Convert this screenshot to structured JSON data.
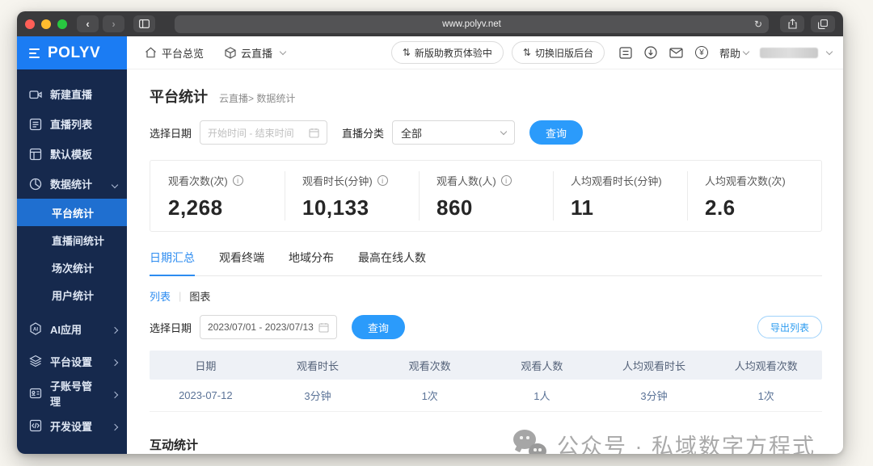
{
  "browser": {
    "url": "www.polyv.net"
  },
  "logo": {
    "text": "POLYV"
  },
  "header": {
    "nav_overview": "平台总览",
    "nav_product": "云直播",
    "pill_new_assistant": "新版助教页体验中",
    "pill_switch_old": "切换旧版后台",
    "help_label": "帮助"
  },
  "sidebar": {
    "items": [
      {
        "label": "新建直播"
      },
      {
        "label": "直播列表"
      },
      {
        "label": "默认模板"
      },
      {
        "label": "数据统计"
      }
    ],
    "sub_items": [
      {
        "label": "平台统计",
        "active": true
      },
      {
        "label": "直播间统计"
      },
      {
        "label": "场次统计"
      },
      {
        "label": "用户统计"
      }
    ],
    "group_items": [
      {
        "label": "AI应用"
      },
      {
        "label": "平台设置"
      },
      {
        "label": "子账号管理"
      },
      {
        "label": "开发设置"
      }
    ]
  },
  "main": {
    "title": "平台统计",
    "breadcrumb": "云直播> 数据统计",
    "filter1": {
      "date_label": "选择日期",
      "date_placeholder": "开始时间 - 结束时间",
      "category_label": "直播分类",
      "category_value": "全部",
      "search_label": "查询"
    },
    "stats": [
      {
        "label": "观看次数(次)",
        "value": "2,268"
      },
      {
        "label": "观看时长(分钟)",
        "value": "10,133"
      },
      {
        "label": "观看人数(人)",
        "value": "860"
      },
      {
        "label": "人均观看时长(分钟)",
        "value": "11"
      },
      {
        "label": "人均观看次数(次)",
        "value": "2.6"
      }
    ],
    "tabs": [
      {
        "label": "日期汇总",
        "active": true
      },
      {
        "label": "观看终端"
      },
      {
        "label": "地域分布"
      },
      {
        "label": "最高在线人数"
      }
    ],
    "view_toggle": {
      "list": "列表",
      "chart": "图表"
    },
    "filter2": {
      "date_label": "选择日期",
      "date_value": "2023/07/01 - 2023/07/13",
      "search_label": "查询",
      "export_label": "导出列表"
    },
    "table": {
      "headers": [
        "日期",
        "观看时长",
        "观看次数",
        "观看人数",
        "人均观看时长",
        "人均观看次数"
      ],
      "rows": [
        [
          "2023-07-12",
          "3分钟",
          "1次",
          "1人",
          "3分钟",
          "1次"
        ]
      ]
    },
    "section2_title": "互动统计",
    "watermark_text": "公众号 · 私域数字方程式"
  },
  "colors": {
    "brand_blue": "#1b7cf3",
    "sidebar_navy": "#16294d",
    "sidebar_active_blue": "#1f6fd0",
    "accent_button_blue": "#2b9bfb",
    "link_blue": "#2d8cf0",
    "table_header_bg": "#eef1f6",
    "watermark_gray": "#a9a9a9"
  }
}
